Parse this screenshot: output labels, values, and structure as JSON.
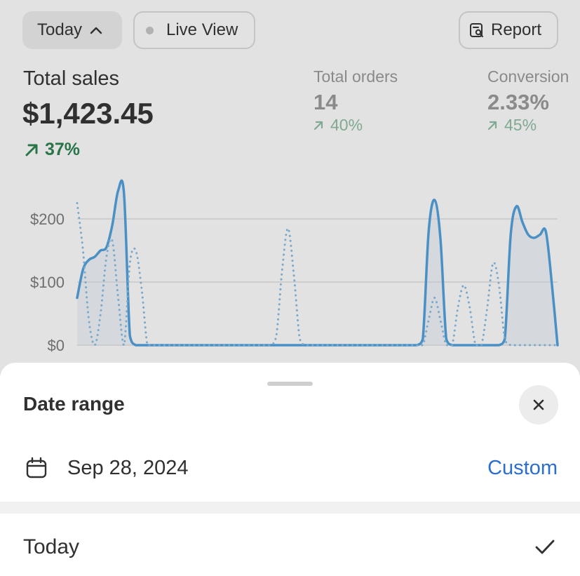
{
  "toolbar": {
    "period_label": "Today",
    "live_view_label": "Live View",
    "report_label": "Report"
  },
  "metrics": {
    "total_sales": {
      "label": "Total sales",
      "value": "$1,423.45",
      "change": "37%"
    },
    "total_orders": {
      "label": "Total orders",
      "value": "14",
      "change": "40%"
    },
    "conversion": {
      "label": "Conversion",
      "value": "2.33%",
      "change": "45%"
    }
  },
  "chart_data": {
    "type": "line",
    "yticks": [
      "$200",
      "$100",
      "$0"
    ],
    "ylim": [
      0,
      250
    ],
    "grid": true,
    "series": [
      {
        "style": "solid",
        "color": "#4a90c4",
        "values": [
          75,
          120,
          135,
          140,
          150,
          155,
          190,
          245,
          240,
          15,
          0,
          0,
          0,
          0,
          0,
          0,
          0,
          0,
          0,
          0,
          0,
          0,
          0,
          0,
          0,
          0,
          0,
          0,
          0,
          0,
          0,
          0,
          0,
          0,
          0,
          0,
          0,
          0,
          0,
          0,
          0,
          0,
          0,
          0,
          0,
          0,
          0,
          0,
          0,
          0,
          0,
          0,
          0,
          0,
          0,
          0,
          0,
          0,
          0,
          10,
          180,
          230,
          170,
          10,
          0,
          0,
          0,
          0,
          0,
          0,
          0,
          0,
          0,
          10,
          175,
          220,
          195,
          175,
          170,
          175,
          180,
          100,
          0
        ]
      },
      {
        "style": "dotted",
        "color": "#7aa8cb",
        "values": [
          225,
          150,
          40,
          0,
          50,
          140,
          165,
          75,
          0,
          130,
          150,
          90,
          0,
          0,
          0,
          0,
          0,
          0,
          0,
          0,
          0,
          0,
          0,
          0,
          0,
          0,
          0,
          0,
          0,
          0,
          0,
          0,
          0,
          0,
          15,
          120,
          185,
          110,
          10,
          0,
          0,
          0,
          0,
          0,
          0,
          0,
          0,
          0,
          0,
          0,
          0,
          0,
          0,
          0,
          0,
          0,
          0,
          0,
          0,
          0,
          40,
          75,
          40,
          0,
          0,
          60,
          95,
          60,
          0,
          0,
          60,
          130,
          95,
          10,
          0,
          0,
          0,
          0,
          0,
          0,
          0,
          0,
          0
        ]
      }
    ]
  },
  "sheet": {
    "title": "Date range",
    "date": "Sep 28, 2024",
    "custom_label": "Custom",
    "options": [
      {
        "label": "Today",
        "selected": true
      }
    ]
  },
  "colors": {
    "accent": "#2c6ecb",
    "trend_up": "#297548",
    "trend_up_muted": "#7fa990",
    "line": "#4a90c4"
  }
}
